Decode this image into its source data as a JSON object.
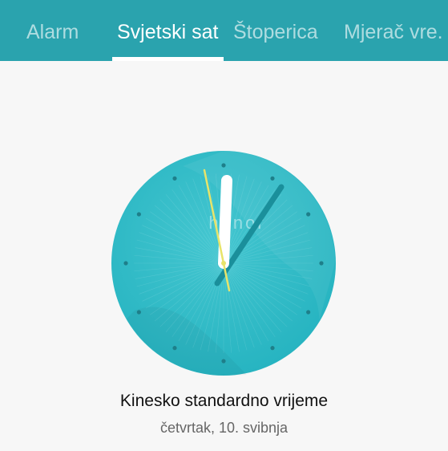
{
  "tabs": {
    "alarm": "Alarm",
    "world_clock": "Svjetski sat",
    "stopwatch": "Štoperica",
    "timer": "Mjerač vre."
  },
  "clock": {
    "brand": "honor",
    "face_color": "#2bb8c4",
    "hour_hand_color": "#ffffff",
    "minute_hand_color": "#1a8f9b",
    "second_hand_color": "#e8e46a",
    "marker_color": "#1e7f8a"
  },
  "world_clock": {
    "zone_name": "Kinesko standardno vrijeme",
    "date": "četvrtak, 10. svibnja"
  },
  "colors": {
    "accent": "#2aa3ae"
  }
}
